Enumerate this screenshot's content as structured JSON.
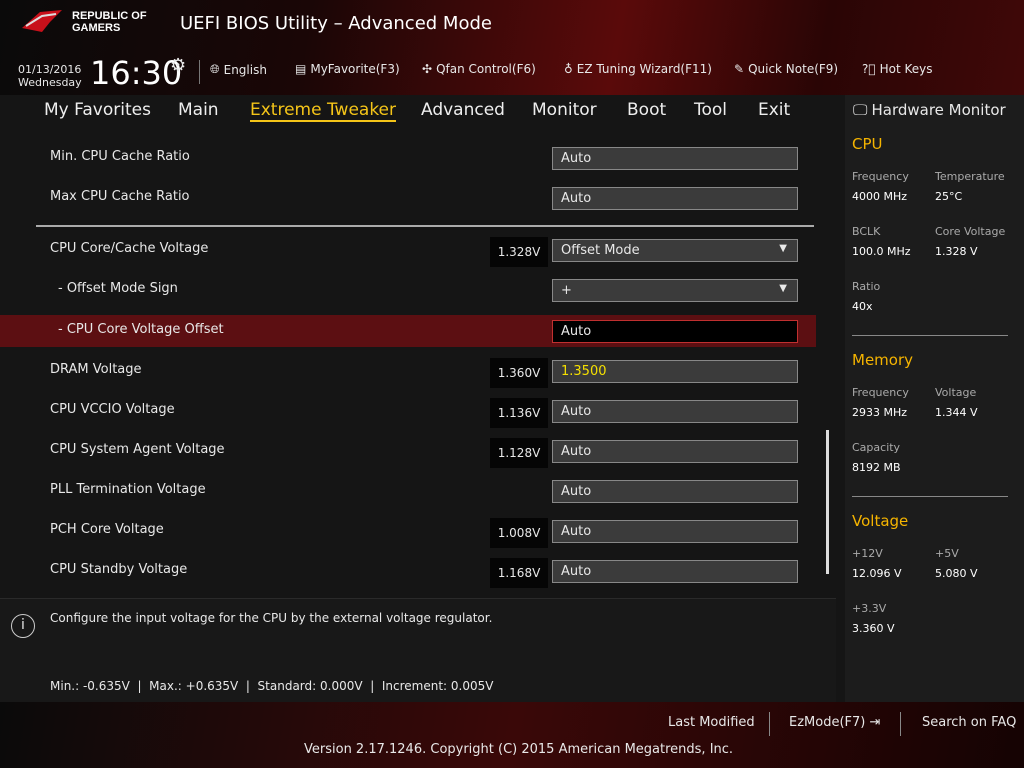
{
  "header": {
    "brand": "REPUBLIC OF GAMERS",
    "title": "UEFI BIOS Utility – Advanced Mode",
    "date": "01/13/2016",
    "day": "Wednesday",
    "time": "16:30",
    "toolbar": [
      {
        "icon": "globe-icon",
        "label": "English"
      },
      {
        "icon": "favorite-icon",
        "label": "MyFavorite(F3)"
      },
      {
        "icon": "fan-icon",
        "label": "Qfan Control(F6)"
      },
      {
        "icon": "bulb-icon",
        "label": "EZ Tuning Wizard(F11)"
      },
      {
        "icon": "note-icon",
        "label": "Quick Note(F9)"
      },
      {
        "icon": "help-icon",
        "label": "Hot Keys"
      }
    ]
  },
  "tabs": [
    "My Favorites",
    "Main",
    "Extreme Tweaker",
    "Advanced",
    "Monitor",
    "Boot",
    "Tool",
    "Exit"
  ],
  "settings": [
    {
      "label": "Min. CPU Cache Ratio",
      "reading": null,
      "value": "Auto",
      "dropdown": false
    },
    {
      "label": "Max CPU Cache Ratio",
      "reading": null,
      "value": "Auto",
      "dropdown": false
    },
    {
      "label": "CPU Core/Cache Voltage",
      "reading": "1.328V",
      "value": "Offset Mode",
      "dropdown": true
    },
    {
      "label": "- Offset Mode Sign",
      "reading": null,
      "value": "+",
      "dropdown": true
    },
    {
      "label": "- CPU Core Voltage Offset",
      "reading": null,
      "value": "Auto",
      "dropdown": false
    },
    {
      "label": "DRAM Voltage",
      "reading": "1.360V",
      "value": "1.3500",
      "dropdown": false
    },
    {
      "label": "CPU VCCIO Voltage",
      "reading": "1.136V",
      "value": "Auto",
      "dropdown": false
    },
    {
      "label": "CPU System Agent Voltage",
      "reading": "1.128V",
      "value": "Auto",
      "dropdown": false
    },
    {
      "label": "PLL Termination Voltage",
      "reading": null,
      "value": "Auto",
      "dropdown": false
    },
    {
      "label": "PCH Core Voltage",
      "reading": "1.008V",
      "value": "Auto",
      "dropdown": false
    },
    {
      "label": "CPU Standby Voltage",
      "reading": "1.168V",
      "value": "Auto",
      "dropdown": false
    }
  ],
  "help": {
    "text": "Configure the input voltage for the CPU by the external voltage regulator.",
    "range": "Min.: -0.635V  |  Max.: +0.635V  |  Standard: 0.000V  |  Increment: 0.005V"
  },
  "monitor": {
    "title": "Hardware Monitor",
    "cpu": {
      "title": "CPU",
      "frequency_label": "Frequency",
      "frequency": "4000 MHz",
      "temp_label": "Temperature",
      "temp": "25°C",
      "bclk_label": "BCLK",
      "bclk": "100.0 MHz",
      "cv_label": "Core Voltage",
      "cv": "1.328 V",
      "ratio_label": "Ratio",
      "ratio": "40x"
    },
    "memory": {
      "title": "Memory",
      "frequency_label": "Frequency",
      "frequency": "2933 MHz",
      "voltage_label": "Voltage",
      "voltage": "1.344 V",
      "capacity_label": "Capacity",
      "capacity": "8192 MB"
    },
    "voltage": {
      "title": "Voltage",
      "v12_label": "+12V",
      "v12": "12.096 V",
      "v5_label": "+5V",
      "v5": "5.080 V",
      "v33_label": "+3.3V",
      "v33": "3.360 V"
    }
  },
  "footer": {
    "last_modified": "Last Modified",
    "ezmode": "EzMode(F7)",
    "search": "Search on FAQ",
    "copyright": "Version 2.17.1246. Copyright (C) 2015 American Megatrends, Inc."
  }
}
